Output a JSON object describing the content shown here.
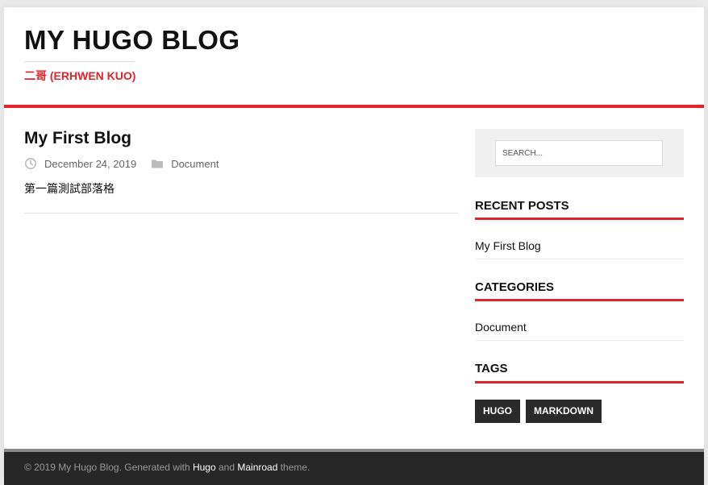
{
  "header": {
    "site_title": "MY HUGO BLOG",
    "site_description": "二哥 (ERHWEN KUO)"
  },
  "colors": {
    "accent": "#e2232b",
    "footer_bg": "#262626",
    "tag_bg": "#2a2a2a"
  },
  "post": {
    "title": "My First Blog",
    "date": "December 24, 2019",
    "category": "Document",
    "excerpt": "第一篇測試部落格",
    "icons": [
      "clock-icon",
      "folder-icon"
    ]
  },
  "sidebar": {
    "search": {
      "placeholder": "SEARCH..."
    },
    "recent_posts": {
      "title": "RECENT POSTS",
      "items": [
        "My First Blog"
      ]
    },
    "categories": {
      "title": "CATEGORIES",
      "items": [
        "Document"
      ]
    },
    "tags": {
      "title": "TAGS",
      "items": [
        "HUGO",
        "MARKDOWN"
      ]
    }
  },
  "footer": {
    "prefix": "© 2019 My Hugo Blog. Generated with ",
    "hugo_link": "Hugo",
    "and": " and ",
    "theme_link": "Mainroad",
    "suffix": " theme."
  }
}
